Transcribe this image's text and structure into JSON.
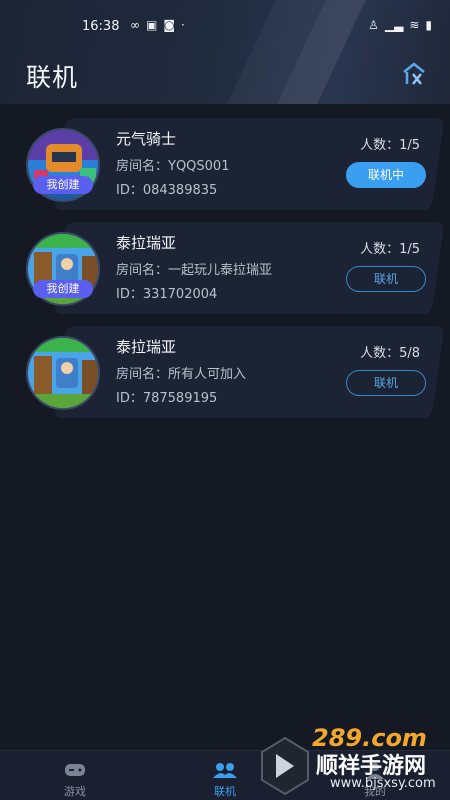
{
  "status_bar": {
    "time": "16:38",
    "left_icons": [
      "link-icon",
      "image-icon",
      "game-icon",
      "more-dots-icon"
    ],
    "right_icons": [
      "person-icon",
      "signal-icon",
      "wifi-icon",
      "battery-icon"
    ]
  },
  "header": {
    "title": "联机",
    "action_icon": "room-swap-icon"
  },
  "rooms": [
    {
      "game_name": "元气骑士",
      "room_name": "房间名：YQQS001",
      "room_id": "ID：084389835",
      "players": "人数：1/5",
      "badge": "我创建",
      "button_label": "联机中",
      "button_state": "active"
    },
    {
      "game_name": "泰拉瑞亚",
      "room_name": "房间名：一起玩儿泰拉瑞亚",
      "room_id": "ID：331702004",
      "players": "人数：1/5",
      "badge": "我创建",
      "button_label": "联机",
      "button_state": "idle"
    },
    {
      "game_name": "泰拉瑞亚",
      "room_name": "房间名：所有人可加入",
      "room_id": "ID：787589195",
      "players": "人数：5/8",
      "badge": "",
      "button_label": "联机",
      "button_state": "idle"
    }
  ],
  "bottom_nav": {
    "items": [
      {
        "label": "游戏",
        "icon": "gamepad-icon",
        "active": false
      },
      {
        "label": "联机",
        "icon": "multiplayer-icon",
        "active": true
      },
      {
        "label": "我的",
        "icon": "profile-icon",
        "active": false
      }
    ]
  },
  "watermark": {
    "brand": "289.com",
    "name": "顺祥手游网",
    "url": "www.bjsxsy.com"
  },
  "colors": {
    "accent": "#3a9ff0",
    "badge": "#5a5ff0",
    "background": "#141923",
    "card": "#1c2334"
  }
}
